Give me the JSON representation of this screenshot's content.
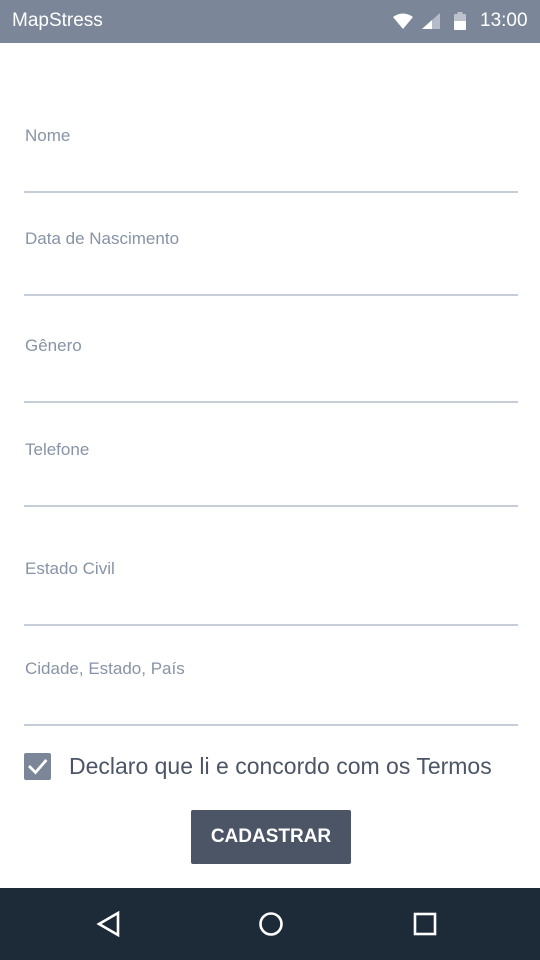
{
  "status_bar": {
    "app_title": "MapStress",
    "time": "13:00",
    "icons": [
      "wifi-icon",
      "signal-icon",
      "battery-icon"
    ]
  },
  "form": {
    "fields": [
      {
        "label": "Nome",
        "value": ""
      },
      {
        "label": "Data de Nascimento",
        "value": ""
      },
      {
        "label": "Gênero",
        "value": ""
      },
      {
        "label": "Telefone",
        "value": ""
      },
      {
        "label": "Estado Civil",
        "value": ""
      },
      {
        "label": "Cidade, Estado, País",
        "value": ""
      }
    ],
    "terms": {
      "checked": true,
      "text": "Declaro que li e concordo com os Termos"
    },
    "submit_label": "CADASTRAR"
  },
  "nav_bar": {
    "icons": [
      "back-icon",
      "home-icon",
      "recents-icon"
    ]
  },
  "colors": {
    "status_bar": "#7b8699",
    "label": "#8793a6",
    "underline": "#c5cdd8",
    "accent": "#7b8699",
    "button": "#4c5566",
    "nav_bar": "#1d2a38"
  }
}
